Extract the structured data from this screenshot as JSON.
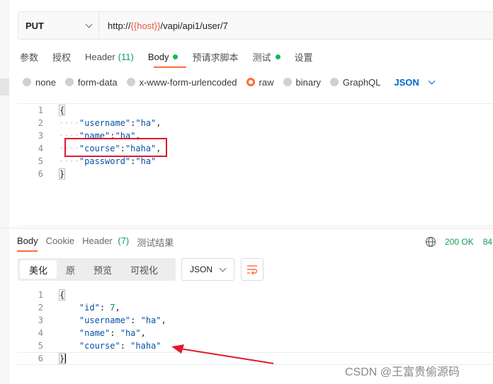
{
  "request": {
    "method": "PUT",
    "url_prefix": "http://",
    "url_var": "{{host}}",
    "url_suffix": "/vapi/api1/user/7"
  },
  "req_tabs": {
    "params": "参数",
    "auth": "授权",
    "header": "Header",
    "header_count": "(11)",
    "body": "Body",
    "prescript": "预请求脚本",
    "tests": "测试",
    "settings": "设置"
  },
  "body_types": {
    "none": "none",
    "form_data": "form-data",
    "urlencoded": "x-www-form-urlencoded",
    "raw": "raw",
    "binary": "binary",
    "graphql": "GraphQL",
    "lang": "JSON"
  },
  "request_body": {
    "line_numbers": [
      "1",
      "2",
      "3",
      "4",
      "5",
      "6"
    ],
    "open": "{",
    "close": "}",
    "k_username": "\"username\"",
    "v_username": "\"ha\"",
    "k_name": "\"name\"",
    "v_name": "\"ha\"",
    "k_course": "\"course\"",
    "v_course": "\"haha\"",
    "k_password": "\"password\"",
    "v_password": "\"ha\""
  },
  "response": {
    "tabs": {
      "body": "Body",
      "cookie": "Cookie",
      "header": "Header",
      "header_count": "(7)",
      "results": "测试结果"
    },
    "status": "200 OK",
    "time": "84",
    "views": {
      "pretty": "美化",
      "raw": "原",
      "preview": "预览",
      "visualize": "可视化"
    },
    "format": "JSON",
    "line_numbers": [
      "1",
      "2",
      "3",
      "4",
      "5",
      "6"
    ],
    "open": "{",
    "close": "}",
    "k_id": "\"id\"",
    "v_id": "7",
    "k_username": "\"username\"",
    "v_username": "\"ha\"",
    "k_name": "\"name\"",
    "v_name": "\"ha\"",
    "k_course": "\"course\"",
    "v_course": "\"haha\""
  },
  "watermark": "CSDN @王富贵偷源码",
  "colors": {
    "accent": "#ff6c37",
    "annotation_red": "#e0192a",
    "status_green": "#0f9d58",
    "link_blue": "#0265d2"
  }
}
